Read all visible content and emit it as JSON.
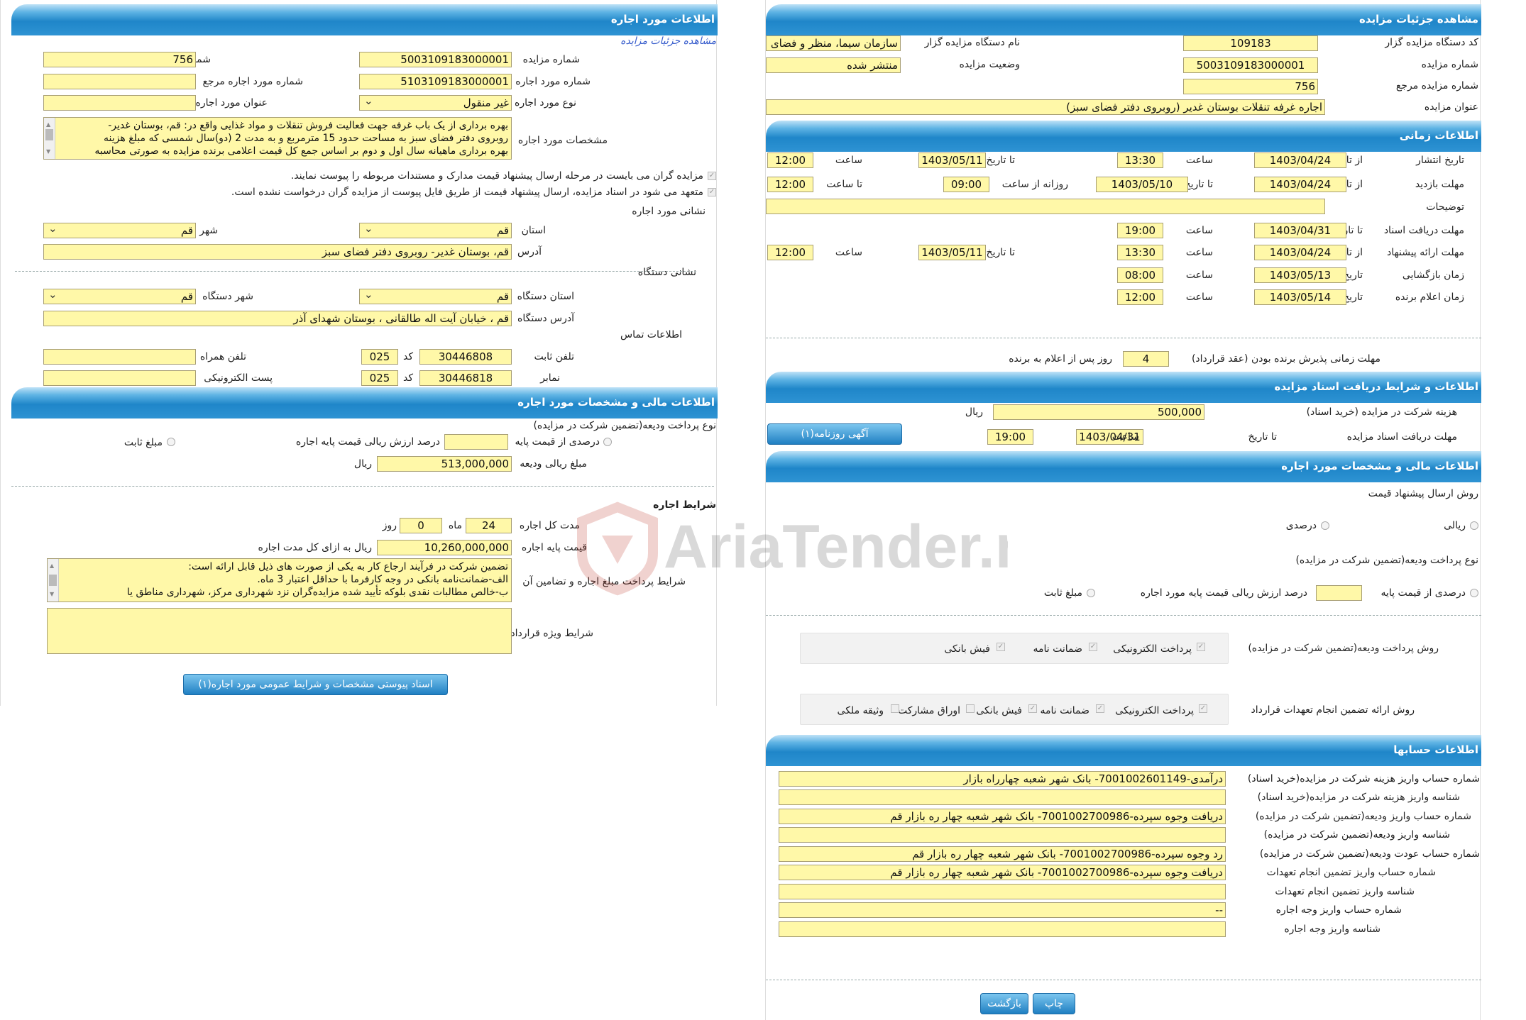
{
  "right": {
    "h_details": "مشاهده جزئیات مزایده",
    "org_code_lbl": "کد دستگاه مزایده گزار",
    "org_code": "109183",
    "org_name_lbl": "نام دستگاه مزایده گزار",
    "org_name": "سازمان سیما، منظر و فضای",
    "auction_no_lbl": "شماره مزایده",
    "auction_no": "5003109183000001",
    "status_lbl": "وضعیت مزایده",
    "status": "منتشر شده",
    "ref_no_lbl": "شماره مزایده مرجع",
    "ref_no": "756",
    "title_lbl": "عنوان مزایده",
    "title": "اجاره غرفه تنقلات بوستان غدیر (روبروی دفتر فضای سبز)",
    "h_time": "اطلاعات زمانی",
    "publish_lbl": "تاریخ انتشار",
    "from_date_lbl": "از تاریخ",
    "to_date_lbl": "تا تاریخ",
    "hour_lbl": "ساعت",
    "to_hour_lbl": "تا ساعت",
    "publish_from": "1403/04/24",
    "publish_from_time": "13:30",
    "publish_to": "1403/05/11",
    "publish_to_time": "12:00",
    "visit_lbl": "مهلت بازدید",
    "visit_from": "1403/04/24",
    "visit_to": "1403/05/10",
    "visit_daily_lbl": "روزانه از ساعت",
    "visit_time_from": "09:00",
    "visit_time_to": "12:00",
    "desc_lbl": "توضیحات",
    "desc": "",
    "docs_lbl": "مهلت دریافت اسناد",
    "docs_to": "1403/04/31",
    "docs_time": "19:00",
    "offer_lbl": "مهلت ارائه پیشنهاد",
    "offer_from": "1403/04/24",
    "offer_from_time": "13:30",
    "offer_to": "1403/05/11",
    "offer_to_time": "12:00",
    "open_lbl": "زمان بازگشایی",
    "date_lbl": "تاریخ",
    "open_date": "1403/05/13",
    "open_time": "08:00",
    "winner_lbl": "زمان اعلام برنده",
    "winner_date": "1403/05/14",
    "winner_time": "12:00",
    "accept_lbl": "مهلت زمانی پذیرش برنده بودن (عقد قرارداد)",
    "accept_days": "4",
    "accept_after": "روز پس از اعلام به برنده",
    "h_docs": "اطلاعات و شرایط دریافت اسناد مزایده",
    "fee_lbl": "هزینه شرکت در مزایده (خرید اسناد)",
    "fee": "500,000",
    "rial": "ریال",
    "docs_deadline_lbl": "مهلت دریافت اسناد مزایده",
    "docs_deadline": "1403/04/31",
    "docs_deadline_time": "19:00",
    "ad_btn": "آگهی روزنامه(۱)",
    "h_fin": "اطلاعات مالی و مشخصات مورد اجاره",
    "price_method_lbl": "روش ارسال پیشنهاد قیمت",
    "rial_opt": "ریالی",
    "pct_opt": "درصدی",
    "deposit_method_lbl": "نوع پرداخت ودیعه(تضمین شرکت در مزایده)",
    "pct_base_opt": "درصدی از قیمت پایه",
    "pct_base_suffix": "درصد ارزش ریالی قیمت پایه مورد اجاره",
    "fixed_opt": "مبلغ ثابت",
    "pay_deposit_lbl": "روش پرداخت ودیعه(تضمین شرکت در مزایده)",
    "epay": "پرداخت الکترونیکی",
    "guarantee": "ضمانت نامه",
    "bank_slip": "فیش بانکی",
    "contract_guar_lbl": "روش ارائه تضمین انجام تعهدات قرارداد",
    "bonds": "اوراق مشارکت",
    "property": "وثیقه ملکی",
    "h_acc": "اطلاعات حسابها",
    "acc1_lbl": "شماره حساب واریز هزینه شرکت در مزایده(خرید اسناد)",
    "acc1": "درآمدی-7001002601149- بانک شهر شعبه چهارراه بازار",
    "acc2_lbl": "شناسه واریز هزینه شرکت در مزایده(خرید اسناد)",
    "acc2": "",
    "acc3_lbl": "شماره حساب واریز ودیعه(تضمین شرکت در مزایده)",
    "acc3": "دریافت وجوه سپرده-7001002700986- بانک شهر شعبه چهار ره بازار قم",
    "acc4_lbl": "شناسه واریز ودیعه(تضمین شرکت در مزایده)",
    "acc4": "",
    "acc5_lbl": "شماره حساب عودت ودیعه(تضمین شرکت در مزایده)",
    "acc5": "رد وجوه سپرده-7001002700986- بانک شهر شعبه چهار ره بازار قم",
    "acc6_lbl": "شماره حساب واریز تضمین انجام تعهدات",
    "acc6": "دریافت وجوه سپرده-7001002700986- بانک شهر شعبه چهار ره بازار قم",
    "acc7_lbl": "شناسه واریز تضمین انجام تعهدات",
    "acc7": "",
    "acc8_lbl": "شماره حساب واریز وجه اجاره",
    "acc8": "--",
    "acc9_lbl": "شناسه واریز وجه اجاره",
    "acc9": "",
    "print_btn": "چاپ",
    "back_btn": "بازگشت"
  },
  "left": {
    "h_item": "اطلاعات مورد اجاره",
    "view_link": "مشاهده جزئیات مزایده",
    "auction_no_lbl": "شماره مزایده",
    "auction_no": "5003109183000001",
    "ref_no_lbl": "شماره مزایده مرجع",
    "ref_no": "756",
    "item_no_lbl": "شماره مورد اجاره",
    "item_no": "5103109183000001",
    "ref_item_lbl": "شماره مورد اجاره مرجع",
    "ref_item": "",
    "type_lbl": "نوع مورد اجاره",
    "type": "غیر منقول",
    "item_title_lbl": "عنوان مورد اجاره",
    "item_title": "",
    "spec_lbl": "مشخصات مورد اجاره",
    "spec_l1": "بهره برداری از یک باب غرفه جهت فعالیت فروش تنقلات و مواد غذایی واقع در: قم، بوستان غدیر-",
    "spec_l2": "روبروی دفتر فضای سبز به مساحت حدود 15 مترمربع و به مدت 2 (دو)سال شمسی که مبلغ هزینه",
    "spec_l3": "بهره برداری ماهیانه سال اول و دوم بر اساس جمع کل قیمت اعلامی برنده مزایده به صورتی محاسبه",
    "note1": "مزایده گران می بایست در مرحله ارسال پیشنهاد قیمت مدارک و مستندات مربوطه را پیوست نمایند.",
    "note2": "متعهد می شود در اسناد مزایده، ارسال پیشنهاد قیمت از طریق فایل پیوست از مزایده گران درخواست نشده است.",
    "addr_h": "نشانی مورد اجاره",
    "prov_lbl": "استان",
    "prov": "قم",
    "city_lbl": "شهر",
    "city": "قم",
    "addr_lbl": "آدرس",
    "addr": "قم، بوستان غدیر- روبروی دفتر فضای سبز",
    "org_addr_h": "نشانی دستگاه",
    "org_prov_lbl": "استان دستگاه",
    "org_prov": "قم",
    "org_city_lbl": "شهر دستگاه",
    "org_city": "قم",
    "org_addr_lbl": "آدرس دستگاه",
    "org_addr": "قم ، خیابان آیت اله طالقانی ، بوستان شهدای آذر",
    "contact_h": "اطلاعات تماس",
    "phone_lbl": "تلفن ثابت",
    "phone": "30446808",
    "code_lbl": "کد",
    "phone_code": "025",
    "mobile_lbl": "تلفن همراه",
    "mobile": "",
    "fax_lbl": "نمابر",
    "fax": "30446818",
    "fax_code": "025",
    "email_lbl": "پست الکترونیکی",
    "email": "",
    "h_fin": "اطلاعات مالی و مشخصات مورد اجاره",
    "deposit_type_lbl": "نوع پرداخت ودیعه(تضمین شرکت در مزایده)",
    "pct_base_opt": "درصدی از قیمت پایه",
    "pct_suffix": "درصد ارزش ریالی قیمت پایه اجاره",
    "fixed_opt": "مبلغ ثابت",
    "deposit_amt_lbl": "مبلغ ریالی ودیعه",
    "deposit_amt": "513,000,000",
    "rial": "ریال",
    "cond_h": "شرایط اجاره",
    "term_lbl": "مدت کل اجاره",
    "months": "24",
    "month_lbl": "ماه",
    "days": "0",
    "day_lbl": "روز",
    "base_lbl": "قیمت پایه اجاره",
    "base": "10,260,000,000",
    "base_suffix": "ریال به ازای کل مدت اجاره",
    "pay_cond_lbl": "شرایط پرداخت مبلغ اجاره و تضامین آن",
    "pay_l1": "تضمین شرکت در فرآیند ارجاع کار به یکی از صورت های ذیل قابل ارائه است:",
    "pay_l2": "الف-ضمانت‌نامه بانکی در وجه کارفرما با حداقل اعتبار 3 ماه.",
    "pay_l3": "ب-خالص مطالبات نقدی بلوکه تأیید شده مزایده‌گران نزد شهرداری مرکز، شهرداری مناطق یا",
    "special_lbl": "شرایط ویژه قرارداد",
    "special": "",
    "attach_btn": "اسناد پیوستی مشخصات و شرایط عمومی مورد اجاره(۱)"
  },
  "watermark": "AriaTender.neT"
}
